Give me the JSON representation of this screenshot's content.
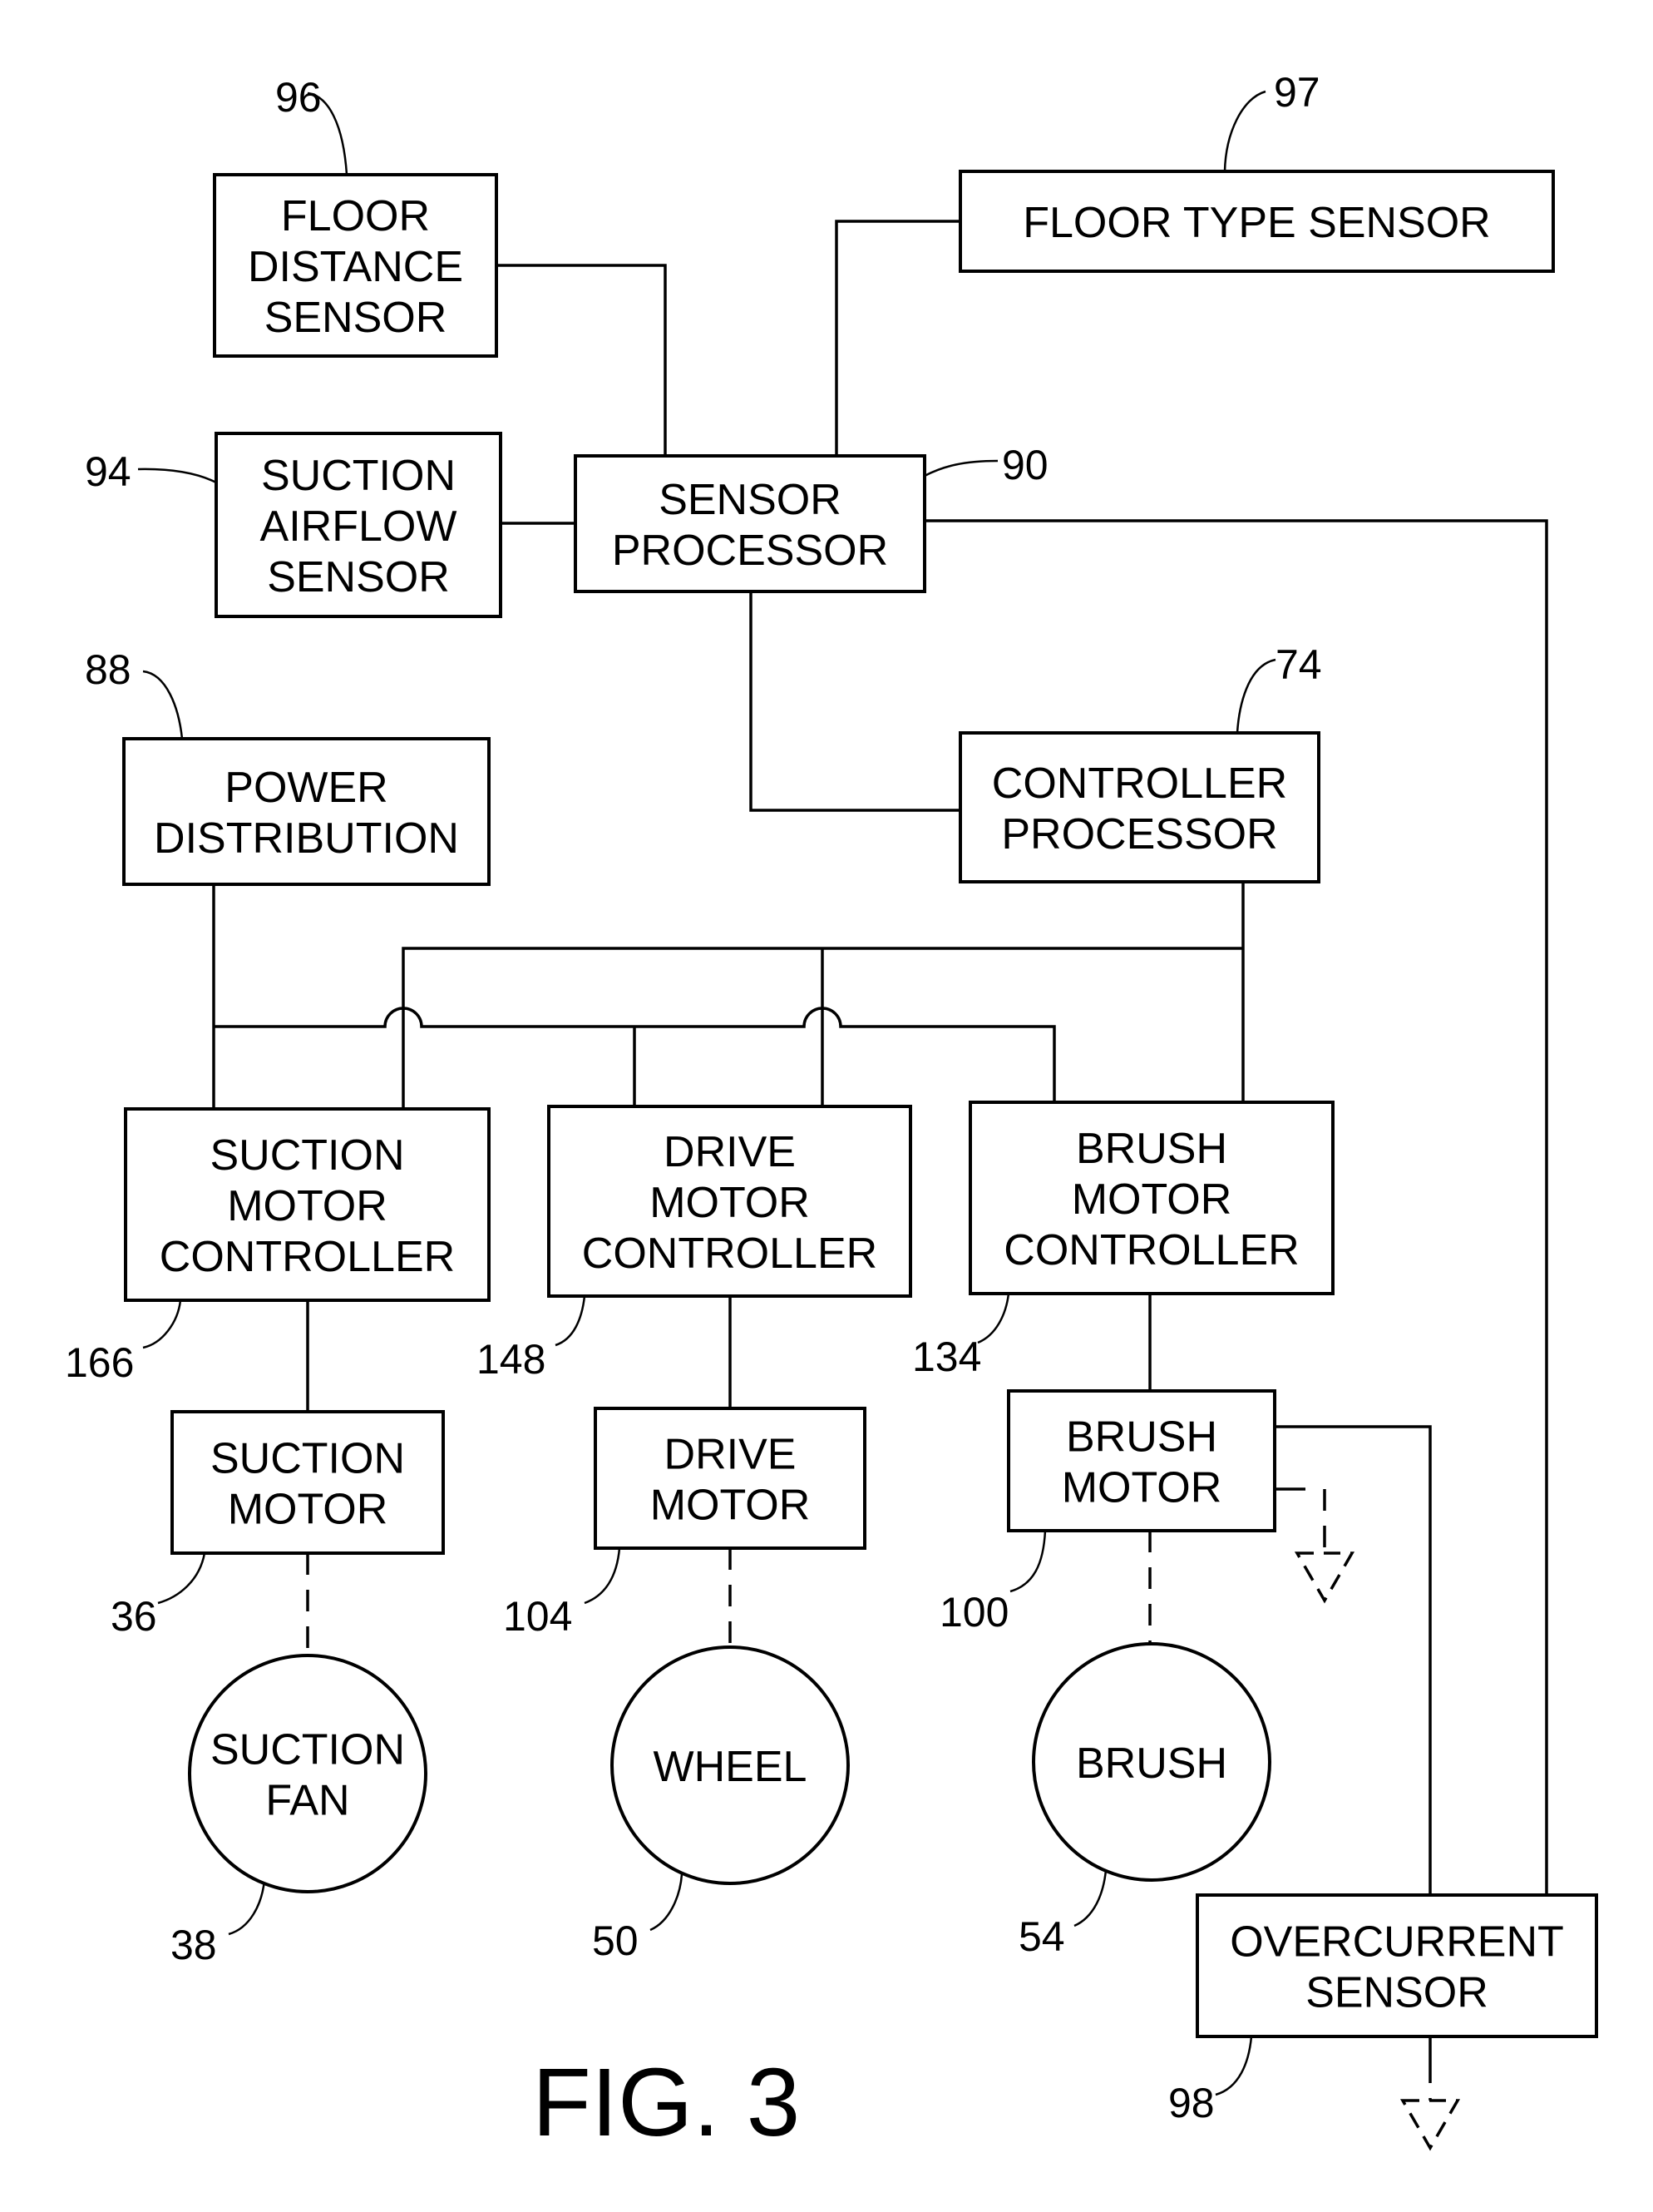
{
  "figure": {
    "title": "FIG. 3",
    "background": "#ffffff",
    "ink": "#000000"
  },
  "blocks": [
    {
      "id": "floor_distance_sensor",
      "ref": "96",
      "lines": [
        "FLOOR",
        "DISTANCE",
        "SENSOR"
      ],
      "shape": "rect"
    },
    {
      "id": "floor_type_sensor",
      "ref": "97",
      "lines": [
        "FLOOR TYPE SENSOR"
      ],
      "shape": "rect"
    },
    {
      "id": "suction_airflow_sensor",
      "ref": "94",
      "lines": [
        "SUCTION",
        "AIRFLOW",
        "SENSOR"
      ],
      "shape": "rect"
    },
    {
      "id": "sensor_processor",
      "ref": "90",
      "lines": [
        "SENSOR",
        "PROCESSOR"
      ],
      "shape": "rect"
    },
    {
      "id": "power_distribution",
      "ref": "88",
      "lines": [
        "POWER",
        "DISTRIBUTION"
      ],
      "shape": "rect"
    },
    {
      "id": "controller_processor",
      "ref": "74",
      "lines": [
        "CONTROLLER",
        "PROCESSOR"
      ],
      "shape": "rect"
    },
    {
      "id": "suction_motor_controller",
      "ref": "166",
      "lines": [
        "SUCTION",
        "MOTOR",
        "CONTROLLER"
      ],
      "shape": "rect"
    },
    {
      "id": "drive_motor_controller",
      "ref": "148",
      "lines": [
        "DRIVE",
        "MOTOR",
        "CONTROLLER"
      ],
      "shape": "rect"
    },
    {
      "id": "brush_motor_controller",
      "ref": "134",
      "lines": [
        "BRUSH",
        "MOTOR",
        "CONTROLLER"
      ],
      "shape": "rect"
    },
    {
      "id": "suction_motor",
      "ref": "36",
      "lines": [
        "SUCTION",
        "MOTOR"
      ],
      "shape": "rect"
    },
    {
      "id": "drive_motor",
      "ref": "104",
      "lines": [
        "DRIVE",
        "MOTOR"
      ],
      "shape": "rect"
    },
    {
      "id": "brush_motor",
      "ref": "100",
      "lines": [
        "BRUSH",
        "MOTOR"
      ],
      "shape": "rect"
    },
    {
      "id": "suction_fan",
      "ref": "38",
      "lines": [
        "SUCTION",
        "FAN"
      ],
      "shape": "circle"
    },
    {
      "id": "wheel",
      "ref": "50",
      "lines": [
        "WHEEL"
      ],
      "shape": "circle"
    },
    {
      "id": "brush",
      "ref": "54",
      "lines": [
        "BRUSH"
      ],
      "shape": "circle"
    },
    {
      "id": "overcurrent_sensor",
      "ref": "98",
      "lines": [
        "OVERCURRENT",
        "SENSOR"
      ],
      "shape": "rect"
    }
  ],
  "connections": [
    {
      "from": "floor_distance_sensor",
      "to": "sensor_processor",
      "style": "solid"
    },
    {
      "from": "floor_type_sensor",
      "to": "sensor_processor",
      "style": "solid"
    },
    {
      "from": "suction_airflow_sensor",
      "to": "sensor_processor",
      "style": "solid"
    },
    {
      "from": "sensor_processor",
      "to": "controller_processor",
      "style": "solid"
    },
    {
      "from": "sensor_processor",
      "to": "overcurrent_sensor",
      "style": "solid"
    },
    {
      "from": "controller_processor",
      "to": "suction_motor_controller",
      "style": "solid",
      "bus": "control"
    },
    {
      "from": "controller_processor",
      "to": "drive_motor_controller",
      "style": "solid",
      "bus": "control"
    },
    {
      "from": "controller_processor",
      "to": "brush_motor_controller",
      "style": "solid",
      "bus": "control"
    },
    {
      "from": "power_distribution",
      "to": "suction_motor_controller",
      "style": "solid",
      "bus": "power"
    },
    {
      "from": "power_distribution",
      "to": "drive_motor_controller",
      "style": "solid",
      "bus": "power"
    },
    {
      "from": "power_distribution",
      "to": "brush_motor_controller",
      "style": "solid",
      "bus": "power"
    },
    {
      "from": "suction_motor_controller",
      "to": "suction_motor",
      "style": "solid"
    },
    {
      "from": "drive_motor_controller",
      "to": "drive_motor",
      "style": "solid"
    },
    {
      "from": "brush_motor_controller",
      "to": "brush_motor",
      "style": "solid"
    },
    {
      "from": "suction_motor",
      "to": "suction_fan",
      "style": "dashed"
    },
    {
      "from": "drive_motor",
      "to": "wheel",
      "style": "dashed"
    },
    {
      "from": "brush_motor",
      "to": "brush",
      "style": "dashed"
    },
    {
      "from": "brush_motor",
      "to": "overcurrent_sensor",
      "style": "solid"
    },
    {
      "from": "brush_motor",
      "to": "ground",
      "style": "dashed"
    },
    {
      "from": "overcurrent_sensor",
      "to": "ground",
      "style": "dashed"
    }
  ],
  "ground_symbols": [
    {
      "id": "brush_motor_ground",
      "attached_to": "brush_motor"
    },
    {
      "id": "overcurrent_ground",
      "attached_to": "overcurrent_sensor"
    }
  ]
}
